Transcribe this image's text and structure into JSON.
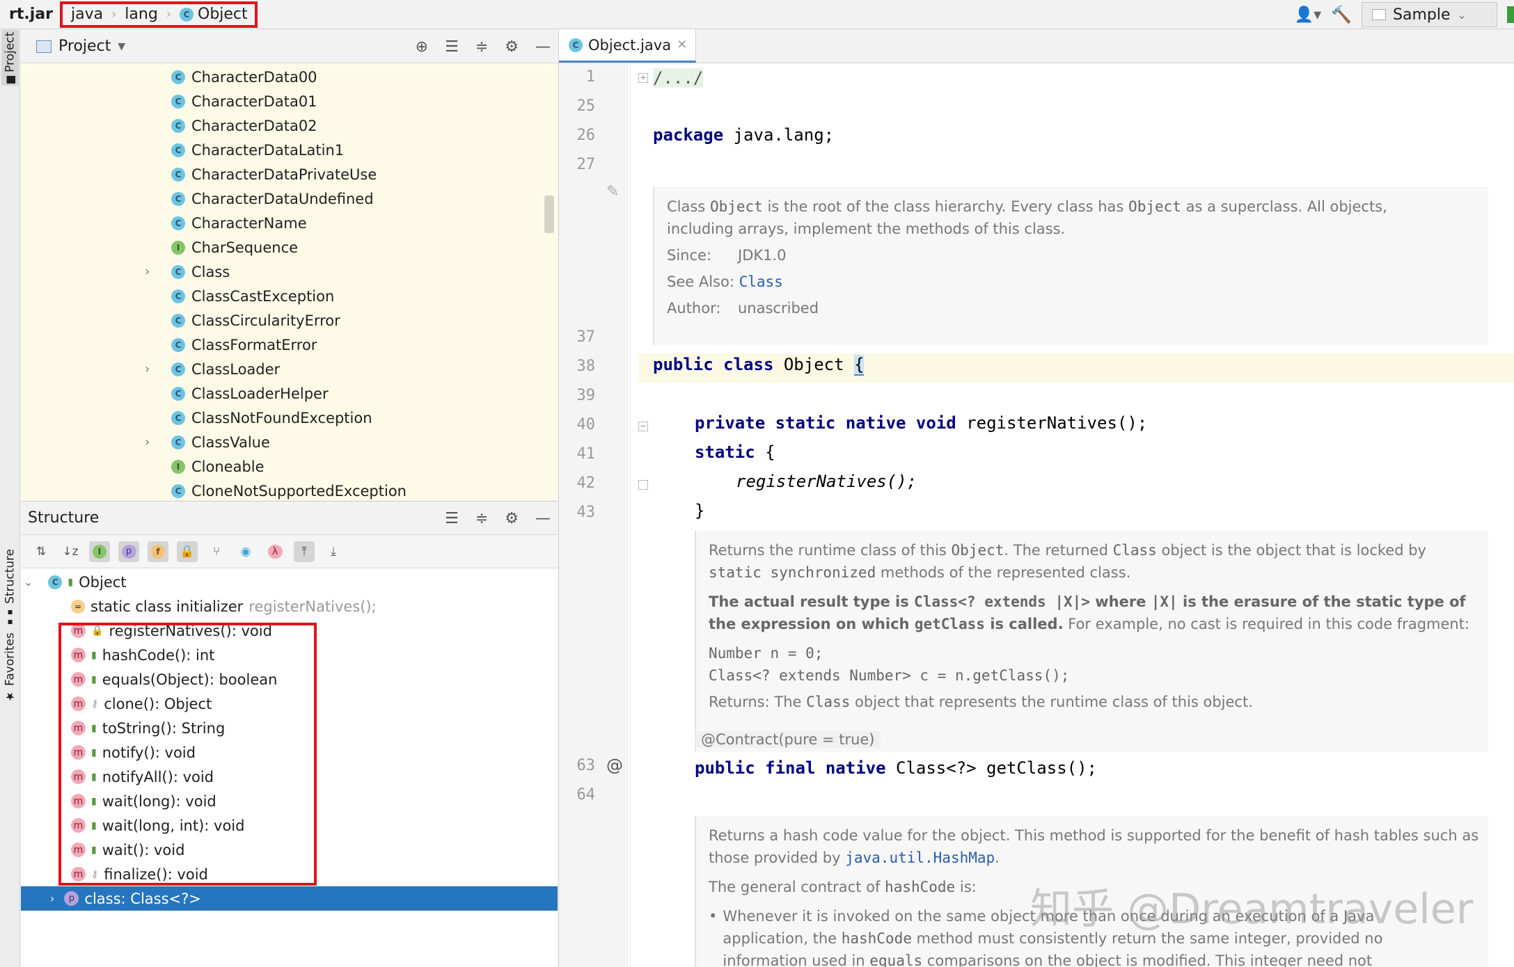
{
  "topbar": {
    "jar": "rt.jar",
    "crumbs": [
      "java",
      "lang",
      "Object"
    ],
    "run_config": "Sample"
  },
  "sidebar_tabs": {
    "project": "Project",
    "structure": "Structure",
    "favorites": "Favorites"
  },
  "project": {
    "title": "Project",
    "items": [
      {
        "name": "CharacterData00",
        "kind": "class"
      },
      {
        "name": "CharacterData01",
        "kind": "class"
      },
      {
        "name": "CharacterData02",
        "kind": "class"
      },
      {
        "name": "CharacterDataLatin1",
        "kind": "class"
      },
      {
        "name": "CharacterDataPrivateUse",
        "kind": "class"
      },
      {
        "name": "CharacterDataUndefined",
        "kind": "class"
      },
      {
        "name": "CharacterName",
        "kind": "class"
      },
      {
        "name": "CharSequence",
        "kind": "interface"
      },
      {
        "name": "Class",
        "kind": "class",
        "expandable": true
      },
      {
        "name": "ClassCastException",
        "kind": "class"
      },
      {
        "name": "ClassCircularityError",
        "kind": "class"
      },
      {
        "name": "ClassFormatError",
        "kind": "class"
      },
      {
        "name": "ClassLoader",
        "kind": "class",
        "expandable": true
      },
      {
        "name": "ClassLoaderHelper",
        "kind": "class"
      },
      {
        "name": "ClassNotFoundException",
        "kind": "class"
      },
      {
        "name": "ClassValue",
        "kind": "class",
        "expandable": true
      },
      {
        "name": "Cloneable",
        "kind": "interface"
      },
      {
        "name": "CloneNotSupportedException",
        "kind": "class"
      }
    ]
  },
  "structure": {
    "title": "Structure",
    "root": "Object",
    "initializer": "static class initializer",
    "initializer_hint": "registerNatives();",
    "methods": [
      "registerNatives(): void",
      "hashCode(): int",
      "equals(Object): boolean",
      "clone(): Object",
      "toString(): String",
      "notify(): void",
      "notifyAll(): void",
      "wait(long): void",
      "wait(long, int): void",
      "wait(): void",
      "finalize(): void"
    ],
    "selected": "class: Class<?>"
  },
  "editor": {
    "tab": "Object.java",
    "lines": {
      "l1": "1",
      "l25": "25",
      "l26": "26",
      "l27": "27",
      "l37": "37",
      "l38": "38",
      "l39": "39",
      "l40": "40",
      "l41": "41",
      "l42": "42",
      "l43": "43",
      "l63": "63",
      "l64": "64"
    },
    "code": {
      "folded": "/.../",
      "package_kw": "package",
      "package_name": " java.lang;",
      "public": "public",
      "class": "class",
      "class_name": " Object ",
      "brace_open": "{",
      "private": "private",
      "static": "static",
      "native": "native",
      "void": "void",
      "register_decl": " registerNatives();",
      "static_block": "static",
      "static_brace": " {",
      "register_call": "registerNatives();",
      "close_brace": "}",
      "annotation": "@Contract(pure = true)",
      "final": "final",
      "getclass_decl": " Class<?> getClass();",
      "at_marker": "@"
    },
    "doc1": {
      "p1": "Class ",
      "p1_code": "Object",
      "p1_b": " is the root of the class hierarchy. Every class has ",
      "p1_code2": "Object",
      "p1_c": " as a superclass. All objects, including arrays, implement the methods of this class.",
      "since_label": "Since:",
      "since_value": "JDK1.0",
      "see_label": "See Also:",
      "see_value": "Class",
      "author_label": "Author:",
      "author_value": "unascribed"
    },
    "doc2": {
      "a": "Returns the runtime class of this ",
      "a_code": "Object",
      "b": ". The returned ",
      "b_code": "Class",
      "c": " object is the object that is locked by ",
      "c_code": "static synchronized",
      "d": " methods of the represented class.",
      "e1": "The actual result type is ",
      "e_code": "Class<? extends |X|>",
      "e2": " where ",
      "e_code2": "|X|",
      "e3": " is the erasure of the static type of the expression on which ",
      "e_code3": "getClass",
      "e4": " is called.",
      "e5": " For example, no cast is required in this code fragment:",
      "code1": "Number n = 0;",
      "code2": "Class<? extends Number> c = n.getClass();",
      "ret_label": "Returns:",
      "ret_a": " The ",
      "ret_code": "Class",
      "ret_b": " object that represents the runtime class of this object."
    },
    "doc3": {
      "a": "Returns a hash code value for the object. This method is supported for the benefit of hash tables such as those provided by ",
      "a_link": "java.util.HashMap",
      "a_end": ".",
      "b": "The general contract of ",
      "b_code": "hashCode",
      "b_end": " is:",
      "bullet_a": "Whenever it is invoked on the same object more than once during an execution of a Java application, the ",
      "bullet_code": "hashCode",
      "bullet_b": " method must consistently return the same integer, provided no information used in ",
      "bullet_code2": "equals",
      "bullet_c": " comparisons on the object is modified. This integer need not"
    }
  },
  "watermark": "知乎 @Dreamtraveler",
  "colors": {
    "highlight": "#e0131b",
    "selection": "#2675bf",
    "keyword": "#000080"
  }
}
